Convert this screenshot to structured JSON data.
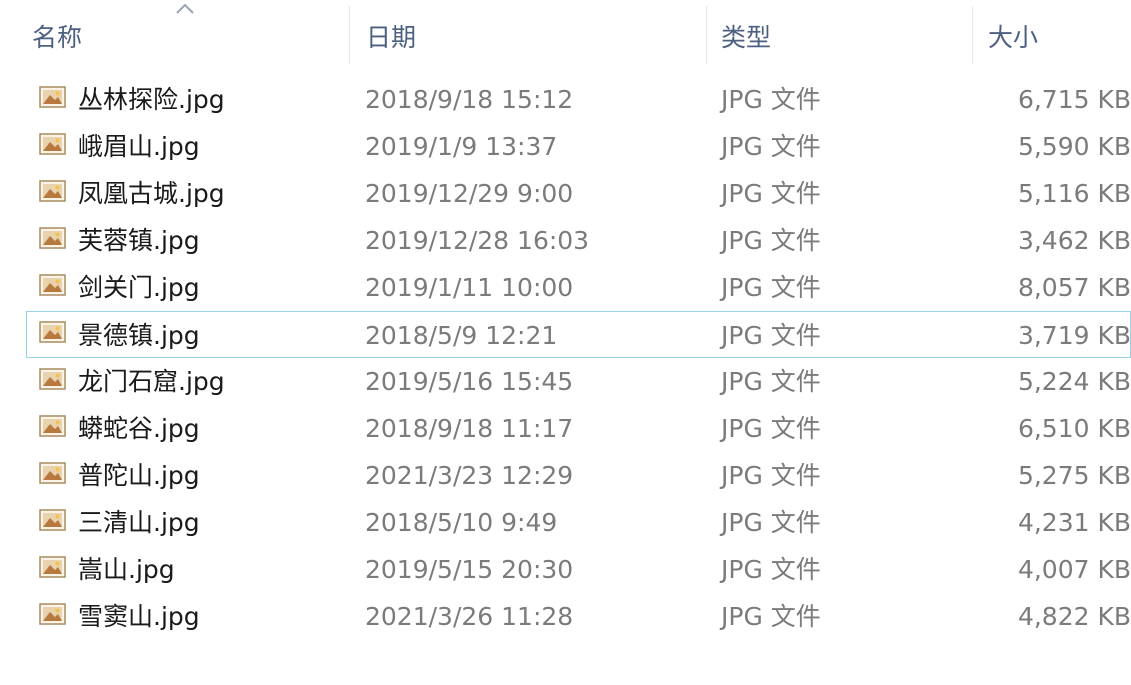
{
  "columns": {
    "name": "名称",
    "date": "日期",
    "type": "类型",
    "size": "大小"
  },
  "sort": {
    "column": "name",
    "direction": "ascending"
  },
  "colors": {
    "header_text": "#4d6082",
    "selection_border": "#99d1ea",
    "secondary_text": "#7b7b7b"
  },
  "files": [
    {
      "name": "丛林探险.jpg",
      "date": "2018/9/18 15:12",
      "type": "JPG 文件",
      "size": "6,715 KB"
    },
    {
      "name": "峨眉山.jpg",
      "date": "2019/1/9 13:37",
      "type": "JPG 文件",
      "size": "5,590 KB"
    },
    {
      "name": "凤凰古城.jpg",
      "date": "2019/12/29 9:00",
      "type": "JPG 文件",
      "size": "5,116 KB"
    },
    {
      "name": "芙蓉镇.jpg",
      "date": "2019/12/28 16:03",
      "type": "JPG 文件",
      "size": "3,462 KB"
    },
    {
      "name": "剑关门.jpg",
      "date": "2019/1/11 10:00",
      "type": "JPG 文件",
      "size": "8,057 KB"
    },
    {
      "name": "景德镇.jpg",
      "date": "2018/5/9 12:21",
      "type": "JPG 文件",
      "size": "3,719 KB"
    },
    {
      "name": "龙门石窟.jpg",
      "date": "2019/5/16 15:45",
      "type": "JPG 文件",
      "size": "5,224 KB"
    },
    {
      "name": "蟒蛇谷.jpg",
      "date": "2018/9/18 11:17",
      "type": "JPG 文件",
      "size": "6,510 KB"
    },
    {
      "name": "普陀山.jpg",
      "date": "2021/3/23 12:29",
      "type": "JPG 文件",
      "size": "5,275 KB"
    },
    {
      "name": "三清山.jpg",
      "date": "2018/5/10 9:49",
      "type": "JPG 文件",
      "size": "4,231 KB"
    },
    {
      "name": "嵩山.jpg",
      "date": "2019/5/15 20:30",
      "type": "JPG 文件",
      "size": "4,007 KB"
    },
    {
      "name": "雪窦山.jpg",
      "date": "2021/3/26 11:28",
      "type": "JPG 文件",
      "size": "4,822 KB"
    }
  ],
  "selected_index": 5,
  "file_icon": "jpg-image-file-icon"
}
